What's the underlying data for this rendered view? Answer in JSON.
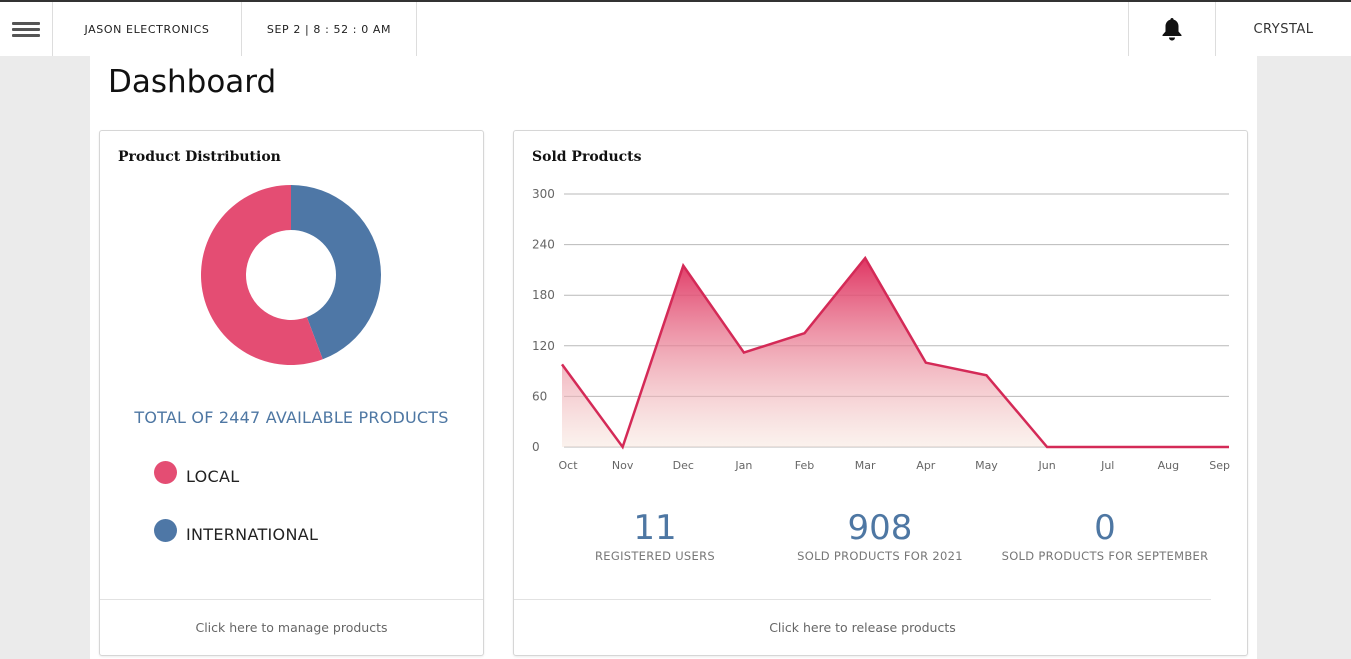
{
  "topbar": {
    "menu_icon": "hamburger-menu-icon",
    "brand": "JASON ELECTRONICS",
    "datetime": "SEP 2 | 8 : 52 : 0 AM",
    "bell_icon": "bell-icon",
    "user": "CRYSTAL"
  },
  "page": {
    "title": "Dashboard"
  },
  "distribution": {
    "title": "Product Distribution",
    "total_text": "TOTAL OF 2447 AVAILABLE PRODUCTS",
    "legend": [
      {
        "label": "LOCAL",
        "color": "#e44d73"
      },
      {
        "label": "INTERNATIONAL",
        "color": "#4e77a6"
      }
    ],
    "footer": "Click here to manage products"
  },
  "sold": {
    "title": "Sold Products",
    "stats": [
      {
        "value": "11",
        "label": "REGISTERED USERS"
      },
      {
        "value": "908",
        "label": "SOLD PRODUCTS FOR 2021"
      },
      {
        "value": "0",
        "label": "SOLD PRODUCTS FOR SEPTEMBER"
      }
    ],
    "footer": "Click here to release products"
  },
  "chart_data": [
    {
      "type": "pie",
      "title": "Product Distribution",
      "labels": [
        "LOCAL",
        "INTERNATIONAL"
      ],
      "values": [
        1364,
        1083
      ],
      "colors": [
        "#e44d73",
        "#4e77a6"
      ]
    },
    {
      "type": "area",
      "title": "Sold Products",
      "categories": [
        "Oct",
        "Nov",
        "Dec",
        "Jan",
        "Feb",
        "Mar",
        "Apr",
        "May",
        "Jun",
        "Jul",
        "Aug",
        "Sep"
      ],
      "values": [
        98,
        0,
        215,
        112,
        135,
        224,
        100,
        85,
        0,
        0,
        0,
        0
      ],
      "yticks": [
        0,
        60,
        120,
        180,
        240,
        300
      ],
      "ylim": [
        0,
        300
      ],
      "grid": true,
      "line_color": "#d42a57"
    }
  ]
}
